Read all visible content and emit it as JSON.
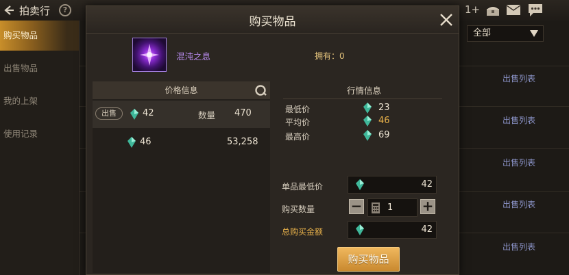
{
  "topbar": {
    "title": "拍卖行",
    "help": "?",
    "right_num": "1+"
  },
  "sidebar": {
    "items": [
      {
        "label": "购买物品"
      },
      {
        "label": "出售物品"
      },
      {
        "label": "我的上架"
      },
      {
        "label": "使用记录"
      }
    ]
  },
  "filter": {
    "selected": "全部"
  },
  "list": {
    "sale_list_link": "出售列表"
  },
  "modal": {
    "title": "购买物品",
    "item": {
      "name": "混沌之息",
      "owned": "拥有：0"
    },
    "price_panel": {
      "header": "价格信息",
      "rows": [
        {
          "badge": "出售",
          "price": "42",
          "qty_label": "数量",
          "qty": "470"
        },
        {
          "price": "46",
          "qty": "53,258"
        }
      ]
    },
    "market": {
      "title": "行情信息",
      "rows": [
        {
          "label": "最低价",
          "value": "23",
          "color": "#ece3d2"
        },
        {
          "label": "平均价",
          "value": "46",
          "color": "#e8b14a"
        },
        {
          "label": "最高价",
          "value": "69",
          "color": "#ece3d2"
        }
      ]
    },
    "form": {
      "unit_min_label": "单品最低价",
      "unit_min_value": "42",
      "qty_label": "购买数量",
      "qty_value": "1",
      "minus": "−",
      "plus": "+",
      "total_label": "总购买金额",
      "total_value": "42"
    },
    "buy_button": "购买物品"
  },
  "colors": {
    "accent_gold": "#e8b14a",
    "item_purple": "#b98cf0",
    "link_blue": "#8c94c9"
  }
}
